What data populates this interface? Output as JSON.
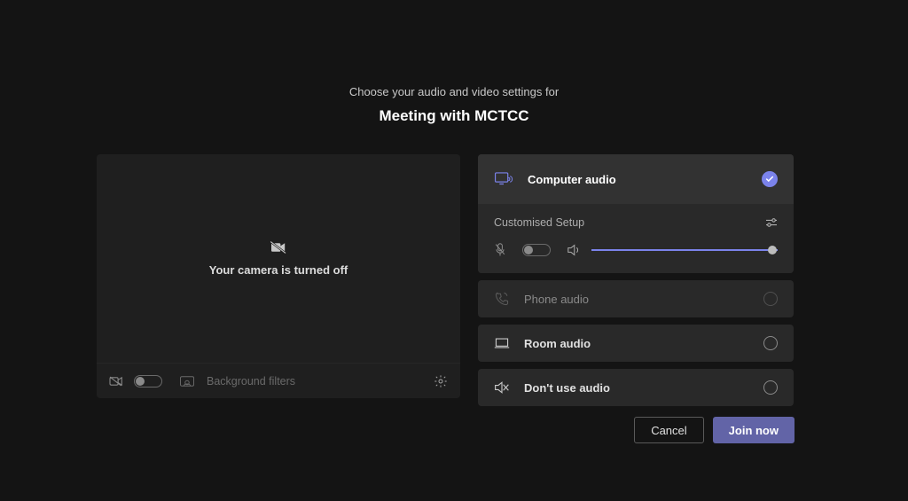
{
  "header": {
    "subtitle": "Choose your audio and video settings for",
    "title": "Meeting with MCTCC"
  },
  "video": {
    "camera_off_label": "Your camera is turned off",
    "background_filters_label": "Background filters"
  },
  "audio": {
    "computer_label": "Computer audio",
    "custom_label": "Customised Setup",
    "phone_label": "Phone audio",
    "room_label": "Room audio",
    "none_label": "Don't use audio"
  },
  "footer": {
    "cancel_label": "Cancel",
    "join_label": "Join now"
  }
}
